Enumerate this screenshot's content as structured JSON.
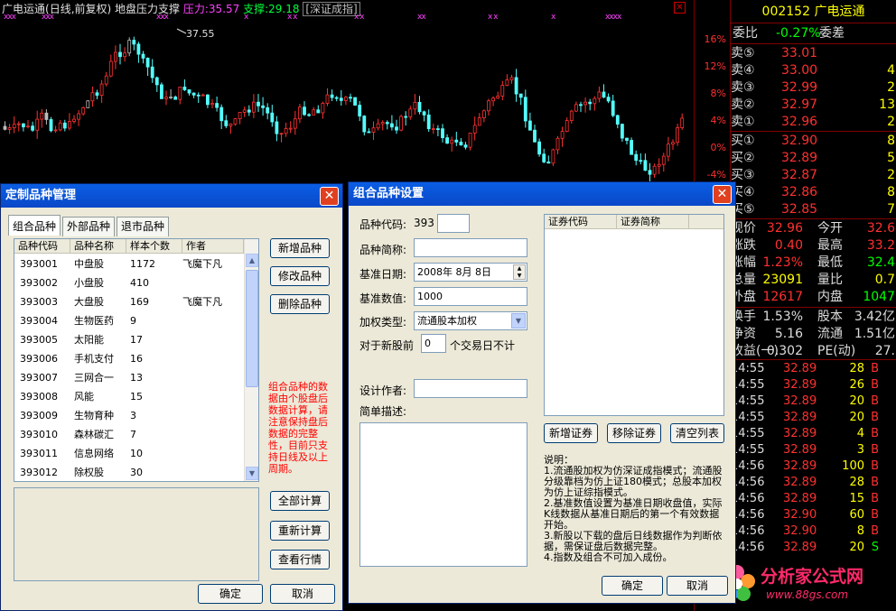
{
  "chart": {
    "stock_name": "广电运通",
    "period": "(日线,前复权)",
    "indicator": "地盘压力支撑",
    "pressure_label": "压力:35.57",
    "support_label": "支撑:29.18",
    "tag": "[深证成指]",
    "peak_label": "37.55",
    "axis_ticks": [
      "16%",
      "12%",
      "8%",
      "4%",
      "0%",
      "-4%"
    ],
    "x_marks": [
      "xxx",
      "xxx",
      "xxx",
      "x",
      "x x",
      "x x",
      "xx",
      "x x",
      "x",
      "xxxx"
    ]
  },
  "quote": {
    "title": "002152 广电运通",
    "ratio_label": "委比",
    "ratio_value": "-0.27%",
    "diff_label": "委差",
    "asks": [
      {
        "label": "卖⑤",
        "price": "33.01",
        "vol": ""
      },
      {
        "label": "卖④",
        "price": "33.00",
        "vol": "4"
      },
      {
        "label": "卖③",
        "price": "32.99",
        "vol": "2"
      },
      {
        "label": "卖②",
        "price": "32.97",
        "vol": "13"
      },
      {
        "label": "卖①",
        "price": "32.96",
        "vol": "2"
      }
    ],
    "bids": [
      {
        "label": "买①",
        "price": "32.90",
        "vol": "8"
      },
      {
        "label": "买②",
        "price": "32.89",
        "vol": "5"
      },
      {
        "label": "买③",
        "price": "32.87",
        "vol": "2"
      },
      {
        "label": "买④",
        "price": "32.86",
        "vol": "8"
      },
      {
        "label": "买⑤",
        "price": "32.85",
        "vol": "7"
      }
    ],
    "stats": [
      {
        "l1": "现价",
        "v1": "32.96",
        "l2": "今开",
        "v2": "32.6"
      },
      {
        "l1": "涨跌",
        "v1": "0.40",
        "l2": "最高",
        "v2": "33.2"
      },
      {
        "l1": "涨幅",
        "v1": "1.23%",
        "l2": "最低",
        "v2": "32.4"
      },
      {
        "l1": "总量",
        "v1": "23091",
        "l2": "量比",
        "v2": "0.7"
      },
      {
        "l1": "外盘",
        "v1": "12617",
        "l2": "内盘",
        "v2": "1047"
      }
    ],
    "stats2": [
      {
        "l1": "换手",
        "v1": "1.53%",
        "l2": "股本",
        "v2": "3.42亿"
      },
      {
        "l1": "净资",
        "v1": "5.16",
        "l2": "流通",
        "v2": "1.51亿"
      },
      {
        "l1": "收益(一)",
        "v1": "0.302",
        "l2": "PE(动)",
        "v2": "27."
      }
    ],
    "ticks": [
      {
        "time": "14:55",
        "price": "32.89",
        "vol": "28",
        "side": "B"
      },
      {
        "time": "14:55",
        "price": "32.89",
        "vol": "26",
        "side": "B"
      },
      {
        "time": "14:55",
        "price": "32.89",
        "vol": "20",
        "side": "B"
      },
      {
        "time": "14:55",
        "price": "32.89",
        "vol": "20",
        "side": "B"
      },
      {
        "time": "14:55",
        "price": "32.89",
        "vol": "4",
        "side": "B"
      },
      {
        "time": "14:55",
        "price": "32.89",
        "vol": "3",
        "side": "B"
      },
      {
        "time": "14:56",
        "price": "32.89",
        "vol": "100",
        "side": "B"
      },
      {
        "time": "14:56",
        "price": "32.89",
        "vol": "28",
        "side": "B"
      },
      {
        "time": "14:56",
        "price": "32.89",
        "vol": "15",
        "side": "B"
      },
      {
        "time": "14:56",
        "price": "32.90",
        "vol": "60",
        "side": "B"
      },
      {
        "time": "14:56",
        "price": "32.90",
        "vol": "8",
        "side": "B"
      },
      {
        "time": "14:56",
        "price": "32.89",
        "vol": "20",
        "side": "S"
      }
    ],
    "logo_text": "分析家公式网",
    "logo_url": "www.88gs.com"
  },
  "left_dialog": {
    "title": "定制品种管理",
    "tabs": [
      "组合品种",
      "外部品种",
      "退市品种"
    ],
    "columns": [
      "品种代码",
      "品种名称",
      "样本个数",
      "作者"
    ],
    "rows": [
      [
        "393001",
        "中盘股",
        "1172",
        "飞魔下凡"
      ],
      [
        "393002",
        "小盘股",
        "410",
        ""
      ],
      [
        "393003",
        "大盘股",
        "169",
        "飞魔下凡"
      ],
      [
        "393004",
        "生物医药",
        "9",
        ""
      ],
      [
        "393005",
        "太阳能",
        "17",
        ""
      ],
      [
        "393006",
        "手机支付",
        "16",
        ""
      ],
      [
        "393007",
        "三网合一",
        "13",
        ""
      ],
      [
        "393008",
        "风能",
        "15",
        ""
      ],
      [
        "393009",
        "生物育种",
        "3",
        ""
      ],
      [
        "393010",
        "森林碳汇",
        "7",
        ""
      ],
      [
        "393011",
        "信息网络",
        "10",
        ""
      ],
      [
        "393012",
        "除权股",
        "30",
        ""
      ]
    ],
    "buttons": {
      "add": "新增品种",
      "edit": "修改品种",
      "delete": "删除品种",
      "calc_all": "全部计算",
      "recalc": "重新计算",
      "view": "查看行情",
      "ok": "确定",
      "cancel": "取消"
    },
    "note": "组合品种的数据由个股盘后数据计算，请注意保持盘后数据的完整性，目前只支持日线及以上周期。"
  },
  "right_dialog": {
    "title": "组合品种设置",
    "code_label": "品种代码:",
    "code_prefix": "393",
    "code_value": "",
    "short_label": "品种简称:",
    "short_value": "",
    "date_label": "基准日期:",
    "date_value": "2008年 8月 8日",
    "base_label": "基准数值:",
    "base_value": "1000",
    "weight_label": "加权类型:",
    "weight_value": "流通股本加权",
    "newstock_label": "对于新股前",
    "newstock_value": "0",
    "newstock_suffix": "个交易日不计",
    "author_label": "设计作者:",
    "author_value": "",
    "desc_label": "简单描述:",
    "desc_value": "",
    "list_columns": [
      "证券代码",
      "证券简称"
    ],
    "buttons": {
      "add": "新增证券",
      "remove": "移除证券",
      "clear": "清空列表",
      "ok": "确定",
      "cancel": "取消"
    },
    "explain_title": "说明：",
    "explain_lines": [
      "1.流通股加权为仿深证成指模式；流通股分级靠档为仿上证180模式；总股本加权为仿上证综指模式。",
      "2.基准数值设置为基准日期收盘值，实际K线数据从基准日期后的第一个有效数据开始。",
      "3.新股以下载的盘后日线数据作为判断依据，需保证盘后数据完整。",
      "4.指数及组合不可加入成份。"
    ]
  }
}
